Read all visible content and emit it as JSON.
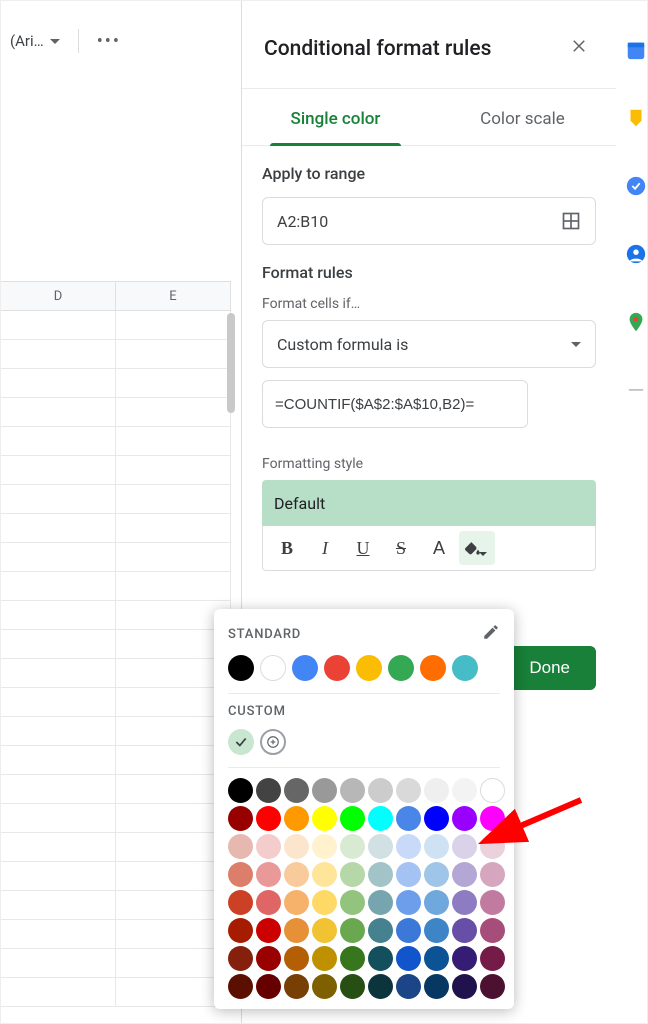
{
  "toolbar": {
    "font_name": "(Ari…"
  },
  "columns": [
    "D",
    "E"
  ],
  "panel": {
    "title": "Conditional format rules",
    "tabs": {
      "single": "Single color",
      "scale": "Color scale"
    },
    "apply_label": "Apply to range",
    "range_value": "A2:B10",
    "rules_label": "Format rules",
    "cells_if_label": "Format cells if…",
    "condition_value": "Custom formula is",
    "formula_value": "=COUNTIF($A$2:$A$10,B2)=",
    "style_label": "Formatting style",
    "style_preview": "Default",
    "done": "Done"
  },
  "picker": {
    "standard_label": "STANDARD",
    "custom_label": "CUSTOM",
    "standard_colors": [
      "#000000",
      "#ffffff",
      "#4285f4",
      "#ea4335",
      "#fbbc04",
      "#34a853",
      "#ff6d01",
      "#46bdc6"
    ],
    "palette": [
      "#000000",
      "#434343",
      "#666666",
      "#999999",
      "#b7b7b7",
      "#cccccc",
      "#d9d9d9",
      "#efefef",
      "#f3f3f3",
      "#ffffff",
      "#980000",
      "#ff0000",
      "#ff9900",
      "#ffff00",
      "#00ff00",
      "#00ffff",
      "#4a86e8",
      "#0000ff",
      "#9900ff",
      "#ff00ff",
      "#e6b8af",
      "#f4cccc",
      "#fce5cd",
      "#fff2cc",
      "#d9ead3",
      "#d0e0e3",
      "#c9daf8",
      "#cfe2f3",
      "#d9d2e9",
      "#ead1dc",
      "#dd7e6b",
      "#ea9999",
      "#f9cb9c",
      "#ffe599",
      "#b6d7a8",
      "#a2c4c9",
      "#a4c2f4",
      "#9fc5e8",
      "#b4a7d6",
      "#d5a6bd",
      "#cc4125",
      "#e06666",
      "#f6b26b",
      "#ffd966",
      "#93c47d",
      "#76a5af",
      "#6d9eeb",
      "#6fa8dc",
      "#8e7cc3",
      "#c27ba0",
      "#a61c00",
      "#cc0000",
      "#e69138",
      "#f1c232",
      "#6aa84f",
      "#45818e",
      "#3c78d8",
      "#3d85c6",
      "#674ea7",
      "#a64d79",
      "#85200c",
      "#990000",
      "#b45f06",
      "#bf9000",
      "#38761d",
      "#134f5c",
      "#1155cc",
      "#0b5394",
      "#351c75",
      "#741b47",
      "#5b0f00",
      "#660000",
      "#783f04",
      "#7f6000",
      "#274e13",
      "#0c343d",
      "#1c4587",
      "#073763",
      "#20124d",
      "#4c1130"
    ]
  }
}
